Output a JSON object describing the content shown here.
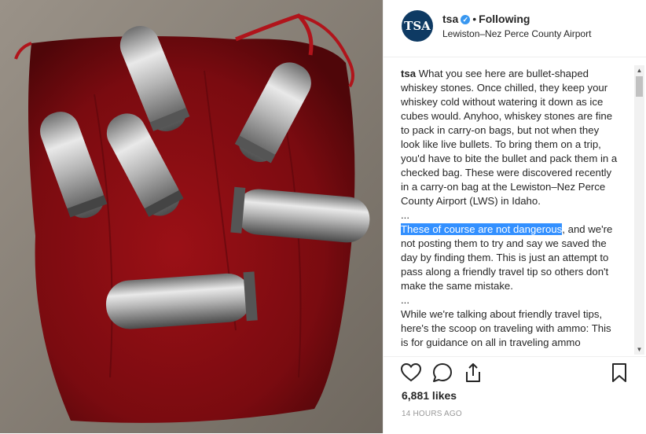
{
  "post": {
    "avatar_text": "TSA",
    "username": "tsa",
    "separator": "•",
    "follow_status": "Following",
    "location": "Lewiston–Nez Perce County Airport",
    "likes": "6,881 likes",
    "timestamp": "14 HOURS AGO"
  },
  "caption": {
    "username": "tsa",
    "part1": " What you see here are bullet-shaped whiskey stones. Once chilled, they keep your whiskey cold without watering it down as ice cubes would. Anyhoo, whiskey stones are fine to pack in carry-on bags, but not when they look like live bullets. To bring them on a trip, you'd have to bite the bullet and pack them in a checked bag. These were discovered recently in a carry-on bag at the Lewiston–Nez Perce County Airport (LWS) in Idaho.\n...\n",
    "highlight": "These of course are not dangerous",
    "part2": ", and we're not posting them to try and say we saved the day by finding them. This is just an attempt to pass along a friendly travel tip so others don't make the same mistake.\n...\nWhile we're talking about friendly travel tips, here's the scoop on traveling with ammo: This is for guidance on all in traveling ammo"
  },
  "icons": {
    "like": "heart-icon",
    "comment": "comment-icon",
    "share": "share-icon",
    "save": "bookmark-icon",
    "verified": "verified-badge-icon"
  },
  "colors": {
    "avatar_bg": "#0e3a63",
    "selection": "#3390ff",
    "verified": "#3897f0"
  }
}
